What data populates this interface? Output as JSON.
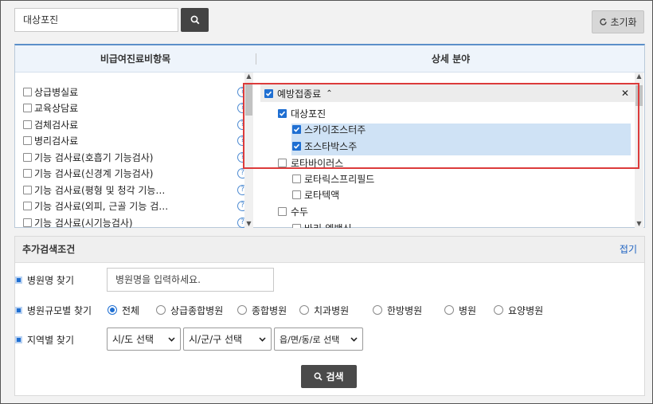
{
  "search": {
    "value": "대상포진"
  },
  "reset_label": "초기화",
  "panel": {
    "left_header": "비급여진료비항목",
    "right_header": "상세 분야"
  },
  "left_items": [
    "상급병실료",
    "교육상담료",
    "검체검사료",
    "병리검사료",
    "기능 검사료(호흡기 기능검사)",
    "기능 검사료(신경계 기능검사)",
    "기능 검사료(평형 및 청각 기능…",
    "기능 검사료(외피, 근골 기능 검…",
    "기능 검사료(시기능검사)"
  ],
  "right_tree": {
    "root": "예방접종료",
    "collapse_symbol": "⌃",
    "close_symbol": "✕",
    "n1": "대상포진",
    "n1a": "스카이조스터주",
    "n1b": "조스타박스주",
    "n2": "로타바이러스",
    "n2a": "로타릭스프리필드",
    "n2b": "로타텍액",
    "n3": "수두",
    "n3a": "바리-엘백신"
  },
  "adv": {
    "title": "추가검색조건",
    "collapse_label": "접기",
    "hospital_name_label": "병원명 찾기",
    "hospital_name_placeholder": "병원명을 입력하세요.",
    "size_label": "병원규모별 찾기",
    "size_options": [
      "전체",
      "상급종합병원",
      "종합병원",
      "치과병원",
      "한방병원",
      "병원",
      "요양병원"
    ],
    "size_selected": "전체",
    "region_label": "지역별 찾기",
    "selects": [
      "시/도 선택",
      "시/군/구 선택",
      "읍/면/동/로 선택"
    ],
    "search_button": "검색"
  },
  "colors": {
    "accent": "#1f6fd2",
    "highlight": "#cfe2f5",
    "red_box": "#dc3b3b"
  }
}
